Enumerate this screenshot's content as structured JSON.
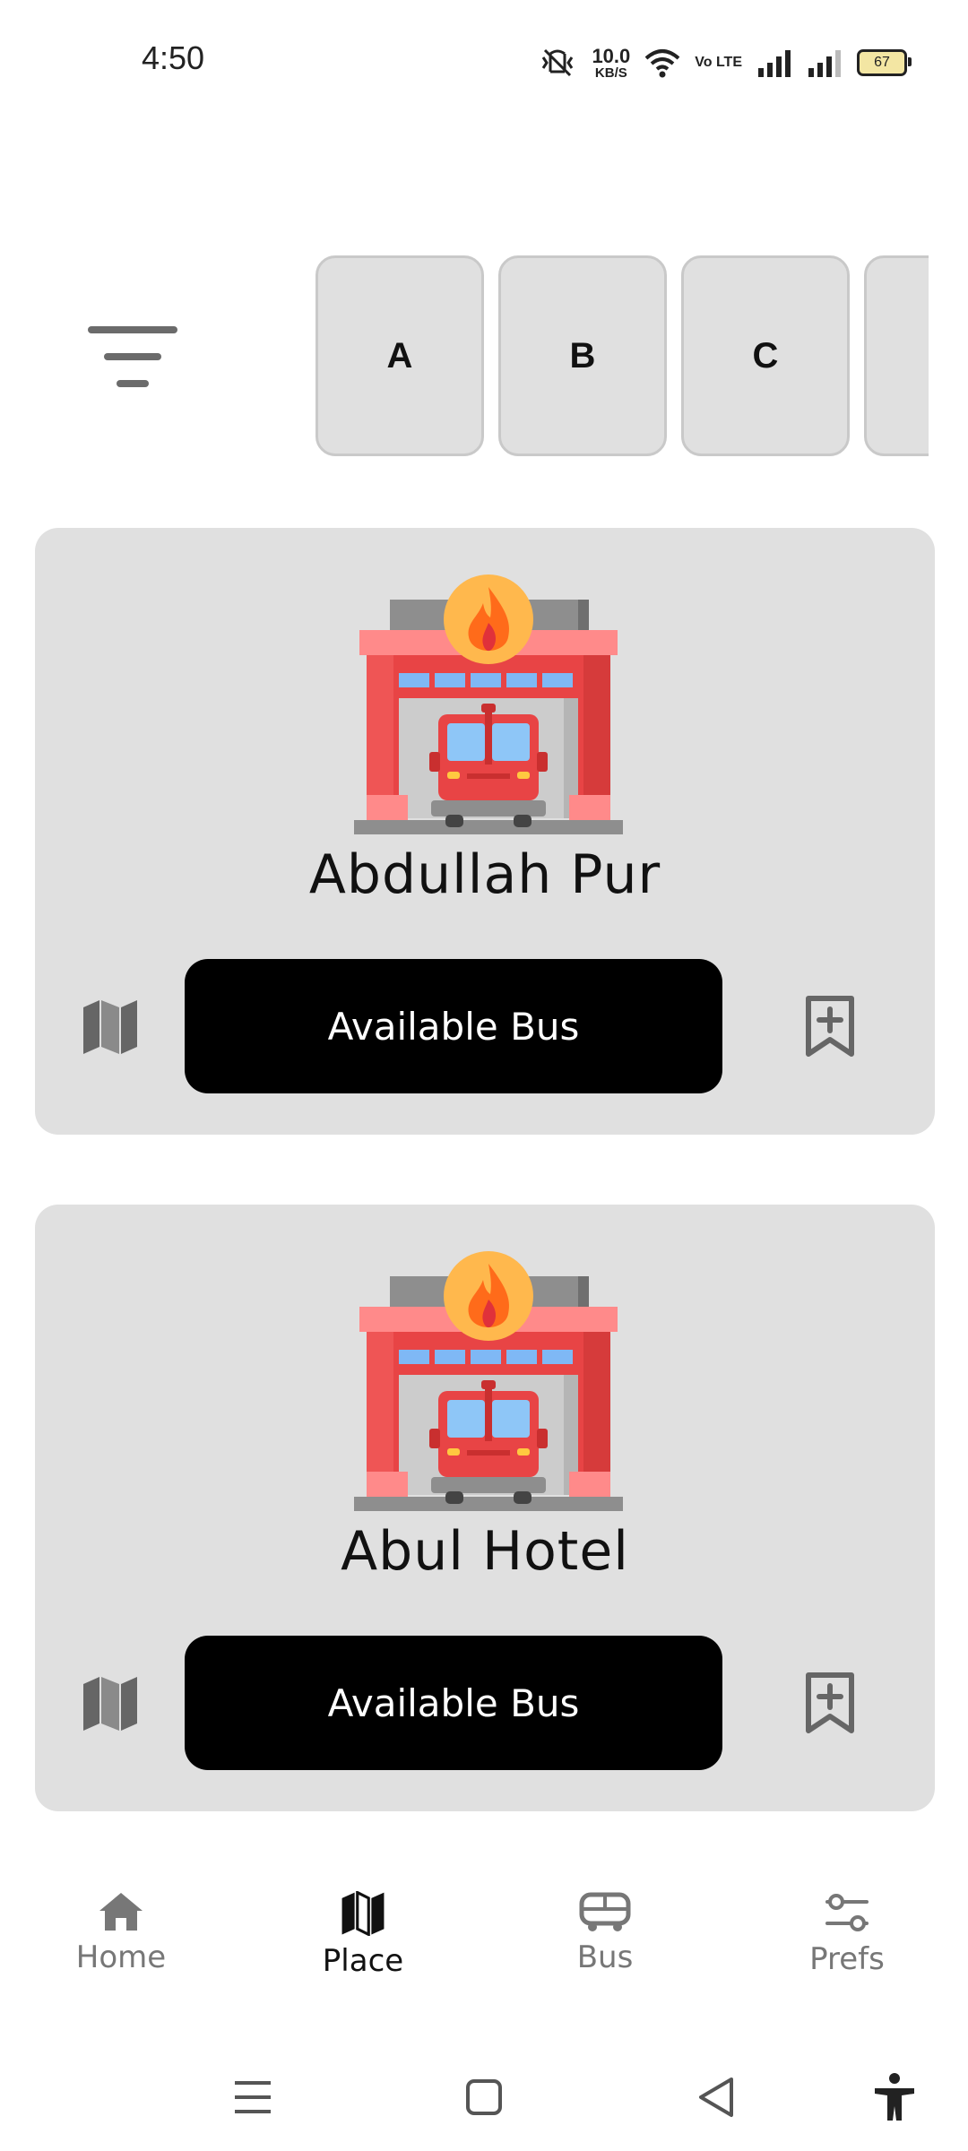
{
  "status_bar": {
    "time": "4:50",
    "net_speed_value": "10.0",
    "net_speed_unit": "KB/S",
    "volte": "Vo LTE",
    "battery": "67"
  },
  "filters": {
    "letters": [
      "A",
      "B",
      "C",
      ""
    ]
  },
  "cards": [
    {
      "name": "Abdullah Pur",
      "button": "Available Bus"
    },
    {
      "name": "Abul Hotel",
      "button": "Available Bus"
    }
  ],
  "bottom_nav": {
    "items": [
      {
        "label": "Home",
        "icon": "home-icon"
      },
      {
        "label": "Place",
        "icon": "map-icon"
      },
      {
        "label": "Bus",
        "icon": "bus-icon"
      },
      {
        "label": "Prefs",
        "icon": "sliders-icon"
      }
    ],
    "active": "Place"
  },
  "colors": {
    "card_bg": "#e0e0e0",
    "button_bg": "#000000",
    "inactive_nav": "#777777",
    "station_red": "#e84445"
  }
}
